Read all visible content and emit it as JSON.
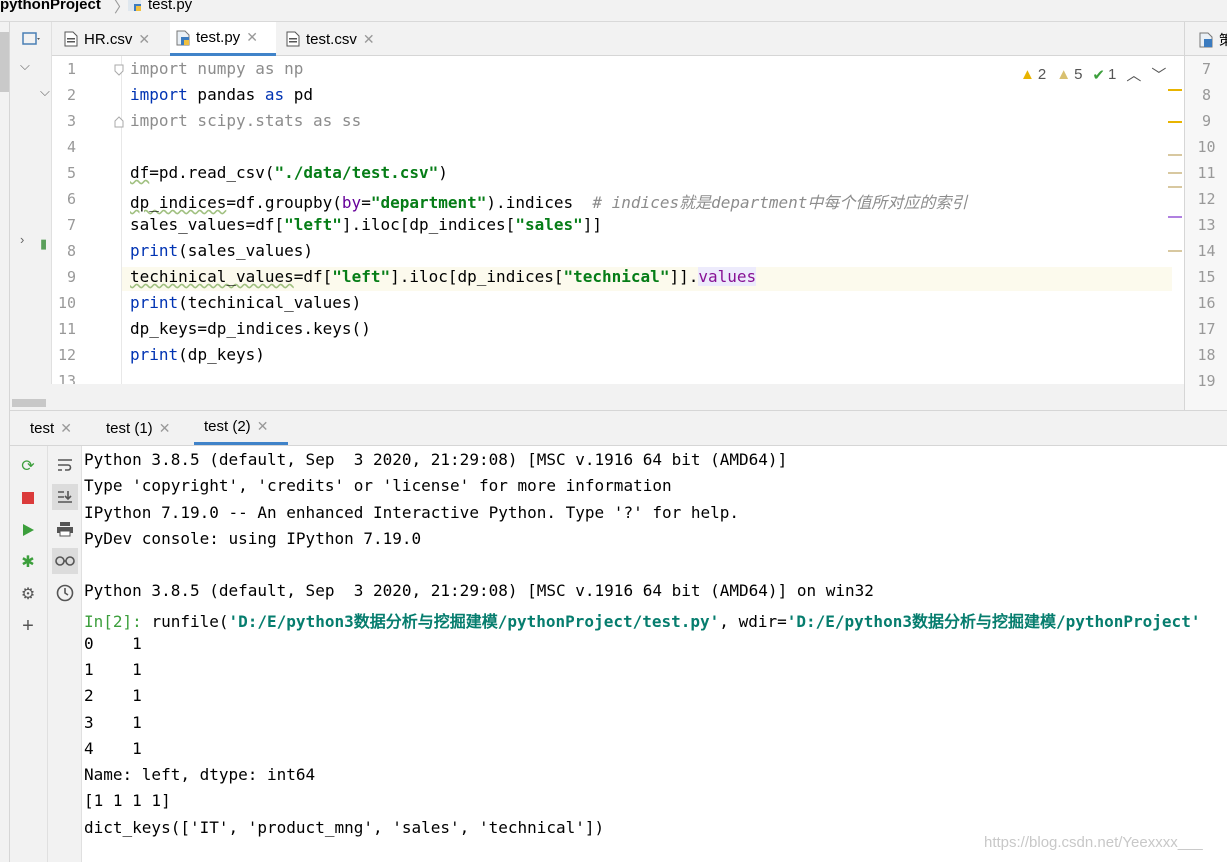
{
  "breadcrumb": {
    "project": "pythonProject",
    "separator": "〉",
    "file": "test.py"
  },
  "editor_tabs": [
    {
      "label": "HR.csv",
      "icon": "csv-file-icon"
    },
    {
      "label": "test.py",
      "icon": "python-file-icon",
      "active": true
    },
    {
      "label": "test.csv",
      "icon": "csv-file-icon"
    }
  ],
  "right_panel": {
    "tab_label": "策",
    "line_numbers": [
      "7",
      "8",
      "9",
      "10",
      "11",
      "12",
      "13",
      "14",
      "15",
      "16",
      "17",
      "18",
      "19"
    ]
  },
  "inspections": {
    "warnings": "2",
    "weak_warnings": "5",
    "typos": "1"
  },
  "code": {
    "line_numbers": [
      "1",
      "2",
      "3",
      "4",
      "5",
      "6",
      "7",
      "8",
      "9",
      "10",
      "11",
      "12",
      "13"
    ],
    "lines": [
      [
        "import",
        " numpy ",
        "as",
        " np"
      ],
      [
        "import",
        " pandas ",
        "as",
        " pd"
      ],
      [
        "import",
        " scipy.stats ",
        "as",
        " ss"
      ],
      [],
      [
        "df",
        "=pd.read_csv(",
        "\"./data/test.csv\"",
        ")"
      ],
      [
        "dp_indices",
        "=df.groupby(",
        "by",
        "=",
        "\"department\"",
        ").indices  ",
        "# indices就是department中每个值所对应的索引"
      ],
      [
        "sales_values=df[",
        "\"left\"",
        "].iloc[dp_indices[",
        "\"sales\"",
        "]]"
      ],
      [
        "print",
        "(sales_values)"
      ],
      [
        "techinical_values",
        "=df[",
        "\"left\"",
        "].iloc[dp_indices[",
        "\"technical\"",
        "]].",
        "values"
      ],
      [
        "print",
        "(techinical_values)"
      ],
      [
        "dp_keys=dp_indices.keys()"
      ],
      [
        "print",
        "(dp_keys)"
      ]
    ]
  },
  "console_tabs": [
    {
      "label": "test"
    },
    {
      "label": "test (1)"
    },
    {
      "label": "test (2)",
      "active": true
    }
  ],
  "console": {
    "lines": [
      "Python 3.8.5 (default, Sep  3 2020, 21:29:08) [MSC v.1916 64 bit (AMD64)]",
      "Type 'copyright', 'credits' or 'license' for more information",
      "IPython 7.19.0 -- An enhanced Interactive Python. Type '?' for help.",
      "PyDev console: using IPython 7.19.0",
      "",
      "Python 3.8.5 (default, Sep  3 2020, 21:29:08) [MSC v.1916 64 bit (AMD64)] on win32"
    ],
    "run_prompt": "In[2]: ",
    "run_call": "runfile(",
    "run_path": "'D:/E/python3数据分析与挖掘建模/pythonProject/test.py'",
    "run_mid": ", wdir=",
    "run_wdir": "'D:/E/python3数据分析与挖掘建模/pythonProject'",
    "output": [
      "0    1",
      "1    1",
      "2    1",
      "3    1",
      "4    1",
      "Name: left, dtype: int64",
      "[1 1 1 1]",
      "dict_keys(['IT', 'product_mng', 'sales', 'technical'])"
    ]
  },
  "watermark": "https://blog.csdn.net/Yeexxxx___",
  "colors": {
    "accent": "#4083c9",
    "keyword": "#0033b3",
    "string": "#067d17",
    "prompt": "#3c9f3c",
    "path": "#067d6e"
  }
}
